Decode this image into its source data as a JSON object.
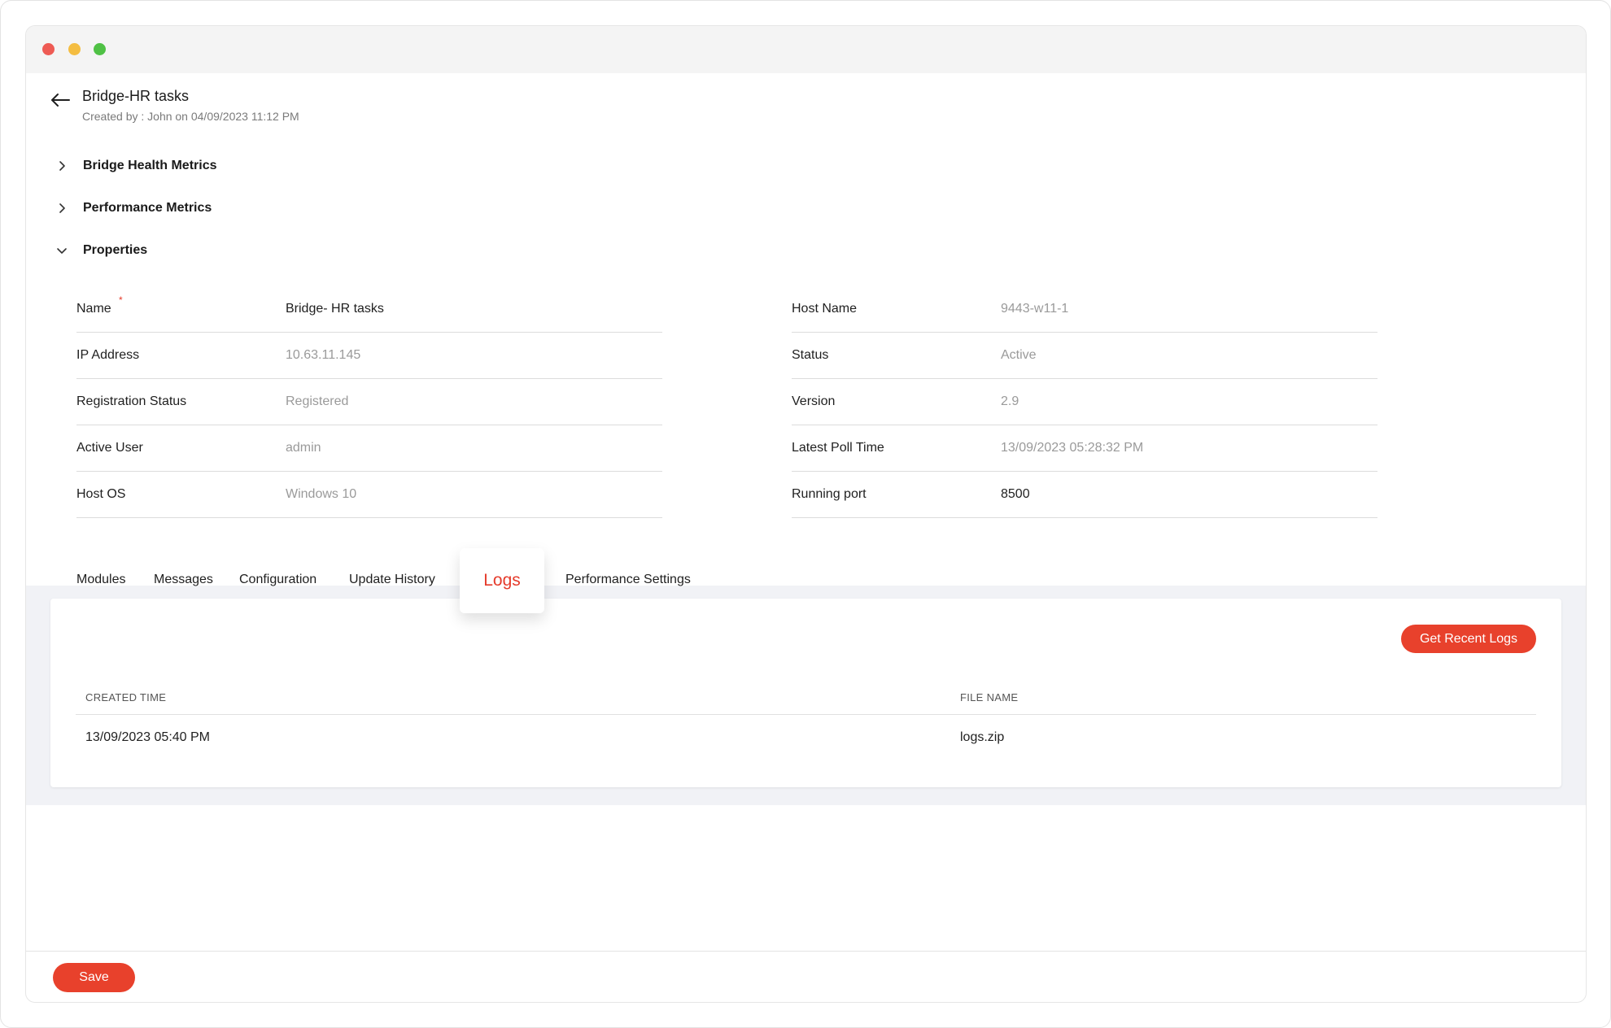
{
  "header": {
    "title": "Bridge-HR tasks",
    "subtitle": "Created by : John on 04/09/2023 11:12 PM"
  },
  "sections": [
    {
      "label": "Bridge Health Metrics",
      "expanded": false
    },
    {
      "label": "Performance Metrics",
      "expanded": false
    },
    {
      "label": "Properties",
      "expanded": true
    }
  ],
  "properties": {
    "left": [
      {
        "name": "Name",
        "value": "Bridge- HR tasks",
        "required": true
      },
      {
        "name": "IP Address",
        "value": "10.63.11.145"
      },
      {
        "name": "Registration Status",
        "value": "Registered"
      },
      {
        "name": "Active User",
        "value": "admin"
      },
      {
        "name": "Host OS",
        "value": "Windows 10"
      }
    ],
    "right": [
      {
        "name": "Host Name",
        "value": "9443-w11-1"
      },
      {
        "name": "Status",
        "value": "Active"
      },
      {
        "name": "Version",
        "value": "2.9"
      },
      {
        "name": "Latest Poll Time",
        "value": "13/09/2023 05:28:32 PM"
      },
      {
        "name": "Running port",
        "value": "8500"
      }
    ]
  },
  "tabs": [
    "Modules",
    "Messages",
    "Configuration",
    "Update History",
    "Logs",
    "Performance Settings"
  ],
  "active_tab": "Logs",
  "logs": {
    "button_label": "Get Recent Logs",
    "columns": [
      "CREATED TIME",
      "FILE NAME"
    ],
    "rows": [
      {
        "created_time": "13/09/2023 05:40 PM",
        "file_name": "logs.zip"
      }
    ]
  },
  "footer": {
    "save_label": "Save"
  },
  "colors": {
    "accent": "#e8412c",
    "band": "#f1f2f6"
  }
}
